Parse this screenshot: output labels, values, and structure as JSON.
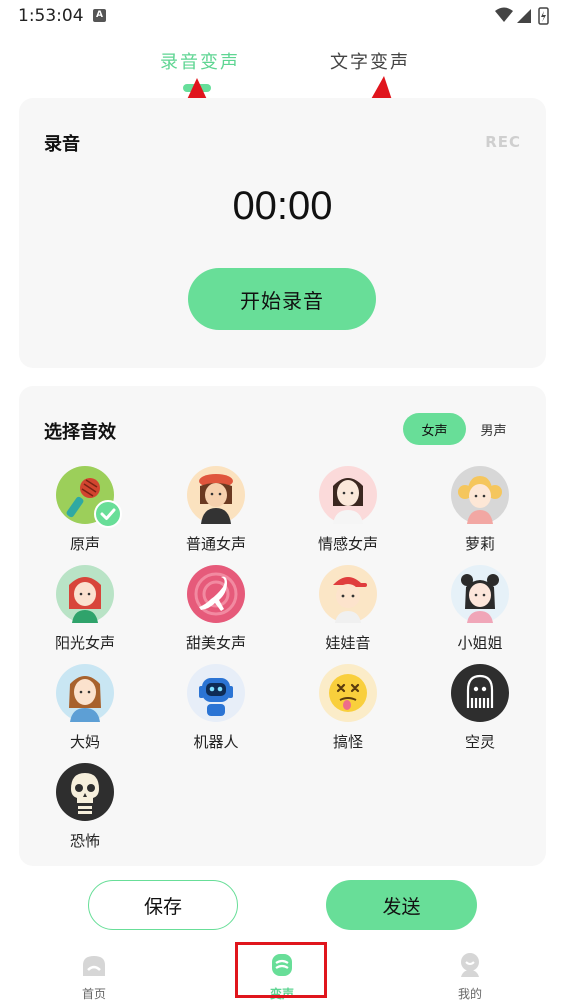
{
  "status_bar": {
    "time": "1:53:04",
    "notification_letter": "A"
  },
  "tabs": [
    {
      "label": "录音变声",
      "active": true
    },
    {
      "label": "文字变声",
      "active": false
    }
  ],
  "record": {
    "title": "录音",
    "rec_label": "REC",
    "timer": "00:00",
    "start_label": "开始录音"
  },
  "effects": {
    "title": "选择音效",
    "gender_options": [
      "女声",
      "男声"
    ],
    "selected_gender": "女声",
    "items": [
      {
        "label": "原声",
        "icon": "microphone-avatar-icon",
        "selected": true
      },
      {
        "label": "普通女声",
        "icon": "girl-beret-avatar-icon"
      },
      {
        "label": "情感女声",
        "icon": "girl-longhair-avatar-icon"
      },
      {
        "label": "萝莉",
        "icon": "blonde-girl-avatar-icon"
      },
      {
        "label": "阳光女声",
        "icon": "red-hair-girl-avatar-icon"
      },
      {
        "label": "甜美女声",
        "icon": "dancer-avatar-icon"
      },
      {
        "label": "娃娃音",
        "icon": "boy-cap-avatar-icon"
      },
      {
        "label": "小姐姐",
        "icon": "girl-buns-avatar-icon"
      },
      {
        "label": "大妈",
        "icon": "auntie-avatar-icon"
      },
      {
        "label": "机器人",
        "icon": "robot-avatar-icon"
      },
      {
        "label": "搞怪",
        "icon": "dizzy-face-avatar-icon"
      },
      {
        "label": "空灵",
        "icon": "ghost-avatar-icon"
      },
      {
        "label": "恐怖",
        "icon": "skull-avatar-icon"
      }
    ]
  },
  "actions": {
    "save_label": "保存",
    "send_label": "发送"
  },
  "bottom_nav": [
    {
      "label": "首页",
      "icon": "home-icon"
    },
    {
      "label": "变声",
      "icon": "voice-change-icon",
      "active": true
    },
    {
      "label": "我的",
      "icon": "profile-icon"
    }
  ],
  "colors": {
    "accent": "#68de98",
    "accent_text": "#5ed592",
    "card_bg": "#f7f7f7",
    "annotation_red": "#e0151d"
  }
}
